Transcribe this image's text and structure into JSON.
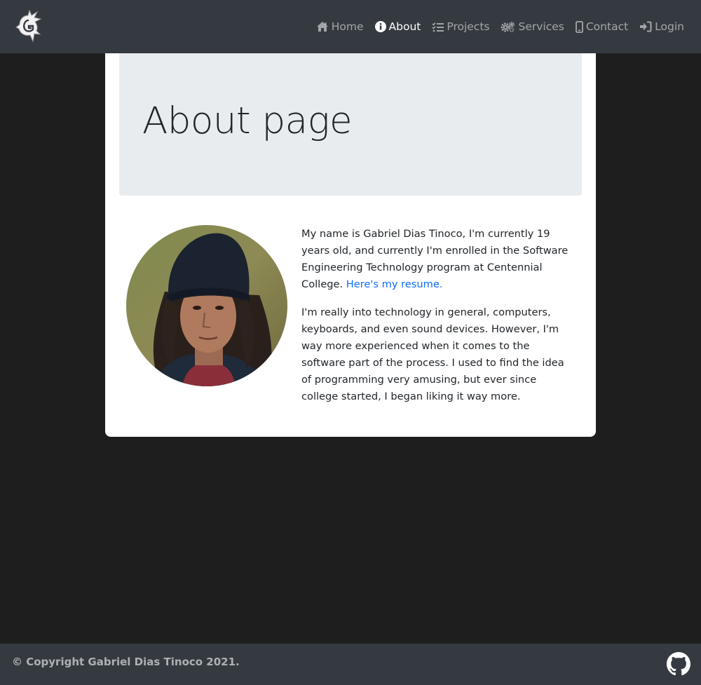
{
  "nav": {
    "items": [
      {
        "label": "Home",
        "icon": "home-icon",
        "active": false
      },
      {
        "label": "About",
        "icon": "info-circle-icon",
        "active": true
      },
      {
        "label": "Projects",
        "icon": "tasks-icon",
        "active": false
      },
      {
        "label": "Services",
        "icon": "cogs-icon",
        "active": false
      },
      {
        "label": "Contact",
        "icon": "mobile-icon",
        "active": false
      },
      {
        "label": "Login",
        "icon": "sign-in-icon",
        "active": false
      }
    ]
  },
  "main": {
    "title": "About page",
    "bio": {
      "p1": "My name is Gabriel Dias Tinoco, I'm currently 19 years old, and currently I'm enrolled in the Software Engineering Technology program at Centennial College.",
      "resume_link": "Here's my resume.",
      "p2": "I'm really into technology in general, computers, keyboards, and even sound devices. However, I'm way more experienced when it comes to the software part of the process. I used to find the idea of programming very amusing, but ever since college started, I began liking it way more."
    }
  },
  "footer": {
    "copyright": "© Copyright Gabriel Dias Tinoco 2021."
  },
  "colors": {
    "navbar": "#343a40",
    "background": "#1e1e1f",
    "jumbotron": "#e9ecef",
    "link": "#0d6efd"
  }
}
